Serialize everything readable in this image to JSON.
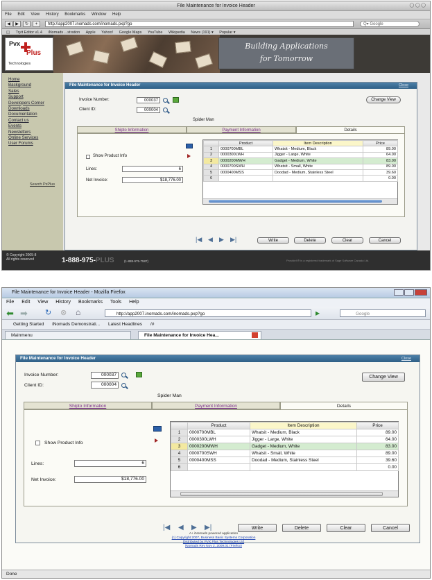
{
  "top": {
    "window_title": "File Maintenance for Invoice Header",
    "menus": [
      "File",
      "Edit",
      "View",
      "History",
      "Bookmarks",
      "Window",
      "Help"
    ],
    "url": "http://app2007.inomads.com/inomads.pxp?go",
    "search_placeholder": "Google",
    "bookmarks": [
      "Tryit Editor v1.4",
      "iNomads ...stration",
      "Apple",
      "Yahoo!",
      "Google Maps",
      "YouTube",
      "Wikipedia",
      "News (191) ▾",
      "Popular ▾"
    ],
    "logo": {
      "pvx": "Pvx",
      "plus": "Plus",
      "tech": "Technologies"
    },
    "tagline_line1": "Building Applications",
    "tagline_line2": "for Tomorrow",
    "sidebar_links": [
      "Home",
      "Background",
      "Sales",
      "Support",
      "Developers Corner",
      "Downloads",
      "Documentation",
      "Contact us",
      "Events",
      "Newsletters",
      "Online Services",
      "User Forums"
    ],
    "search_pvx": "Search PxPlus",
    "copyright_line1": "© Copyright 2005-8",
    "copyright_line2": "All rights reserved",
    "phone": "1-888-975-",
    "phone_plus": "PLUS",
    "phone_small": "(1-888-975-7587)",
    "footnote": "ProvideX® is a registered trademark of Sage Software Canada Ltd."
  },
  "bottom": {
    "window_title": "File Maintenance for Invoice Header - Mozilla Firefox",
    "menus": [
      "File",
      "Edit",
      "View",
      "History",
      "Bookmarks",
      "Tools",
      "Help"
    ],
    "url": "http://app2007.inomads.com/inomads.pxp?go",
    "search_placeholder": "Google",
    "bookmarks": [
      "Getting Started",
      "iNomads Demonstrati...",
      "Latest Headlines",
      "/#"
    ],
    "tabs": [
      "Mainmenu",
      "File Maintenance for Invoice Hea..."
    ],
    "credits": [
      "A+ iNomads powered application",
      "(c) Copyright 2007, Business Basic Systems Corporation",
      "Distributed by PVX Plus Technologies Ltd",
      "iNomads Rev Nov 2, 2009.01 (Firefox)"
    ],
    "status": "Done"
  },
  "form": {
    "header": "File Maintenance for Invoice Header",
    "close": "Close",
    "invoice_label": "Invoice Number:",
    "invoice_value": "000037",
    "client_label": "Client ID:",
    "client_value": "000004",
    "client_name": "Spider Man",
    "change_view": "Change View",
    "tabs": [
      "Shipto Information",
      "Payment Information",
      "Details"
    ],
    "show_product_info": "Show Product Info",
    "lines_label": "Lines:",
    "lines_value": "6",
    "net_label": "Net Invoice:",
    "net_value": "$18,776.00",
    "grid_headers": [
      "Product",
      "Item Description",
      "Price"
    ],
    "rows": [
      {
        "n": "1",
        "product": "0000700MBL",
        "desc": "Whatsit - Medium, Black",
        "price": "89.00"
      },
      {
        "n": "2",
        "product": "0000300LWH",
        "desc": "Jigger - Large, White",
        "price": "64.00"
      },
      {
        "n": "3",
        "product": "0000200MWH",
        "desc": "Gadget - Medium, White",
        "price": "83.00"
      },
      {
        "n": "4",
        "product": "0000700SWH",
        "desc": "Whatsit - Small, White",
        "price": "89.00"
      },
      {
        "n": "5",
        "product": "0000400MSS",
        "desc": "Doodad - Medium, Stainless Steel",
        "price": "39.60"
      },
      {
        "n": "6",
        "product": "",
        "desc": "",
        "price": "0.00"
      }
    ],
    "buttons": [
      "Write",
      "Delete",
      "Clear",
      "Cancel"
    ],
    "nav": [
      "|◀",
      "◀",
      "▶",
      "▶|"
    ]
  }
}
